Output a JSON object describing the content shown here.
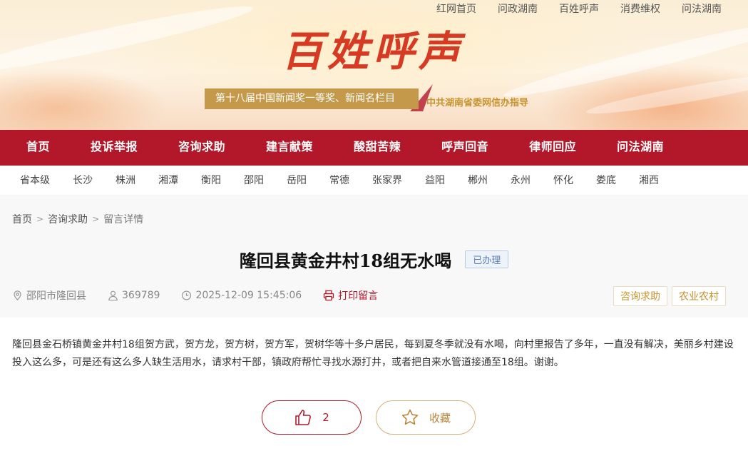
{
  "top_links": [
    "红网首页",
    "问政湖南",
    "百姓呼声",
    "消费维权",
    "问法湖南"
  ],
  "logo_text": "百姓呼声",
  "slogan": "第十八届中国新闻奖一等奖、新闻名栏目",
  "slogan_right": "中共湖南省委网信办指导",
  "main_nav": [
    "首页",
    "投诉举报",
    "咨询求助",
    "建言献策",
    "酸甜苦辣",
    "呼声回音",
    "律师回应",
    "问法湖南"
  ],
  "city_nav": [
    "省本级",
    "长沙",
    "株洲",
    "湘潭",
    "衡阳",
    "邵阳",
    "岳阳",
    "常德",
    "张家界",
    "益阳",
    "郴州",
    "永州",
    "怀化",
    "娄底",
    "湘西"
  ],
  "breadcrumb": {
    "home": "首页",
    "section": "咨询求助",
    "current": "留言详情"
  },
  "post": {
    "title": "隆回县黄金井村18组无水喝",
    "status": "已办理",
    "location": "邵阳市隆回县",
    "user_id": "369789",
    "datetime": "2025-12-09 15:45:06",
    "print_label": "打印留言",
    "tags": [
      "咨询求助",
      "农业农村"
    ],
    "content": "隆回县金石桥镇黄金井村18组贺方武，贺方龙，贺方树，贺方军，贺树华等十多户居民，每到夏冬季就没有水喝，向村里报告了多年，一直没有解决，美丽乡村建设投入这么多，可是还有这么多人缺生活用水，请求村干部，镇政府帮忙寻找水源打井，或者把自来水管道接通至18组。谢谢。"
  },
  "actions": {
    "like_count": "2",
    "favorite_label": "收藏"
  },
  "colors": {
    "brand_red": "#b3182a",
    "gold": "#c7932f",
    "status_blue": "#5a7fb5"
  },
  "icons": [
    "location-icon",
    "user-icon",
    "clock-icon",
    "printer-icon",
    "thumbs-up-icon",
    "star-icon"
  ]
}
